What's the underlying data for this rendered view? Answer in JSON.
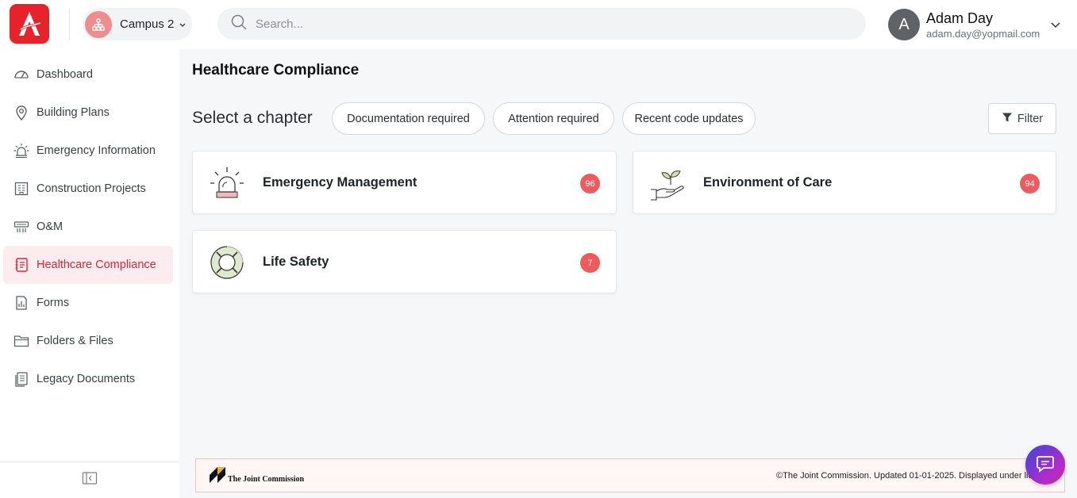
{
  "header": {
    "campus_label": "Campus 2",
    "search_placeholder": "Search...",
    "user": {
      "initial": "A",
      "name": "Adam Day",
      "email": "adam.day@yopmail.com"
    }
  },
  "sidebar": {
    "items": [
      {
        "label": "Dashboard",
        "icon": "speedometer-icon",
        "active": false
      },
      {
        "label": "Building Plans",
        "icon": "map-pin-icon",
        "active": false
      },
      {
        "label": "Emergency Information",
        "icon": "alarm-light-icon",
        "active": false
      },
      {
        "label": "Construction Projects",
        "icon": "building-icon",
        "active": false
      },
      {
        "label": "O&M",
        "icon": "hvac-unit-icon",
        "active": false
      },
      {
        "label": "Healthcare Compliance",
        "icon": "clipboard-icon",
        "active": true
      },
      {
        "label": "Forms",
        "icon": "form-chart-icon",
        "active": false
      },
      {
        "label": "Folders & Files",
        "icon": "folder-icon",
        "active": false
      },
      {
        "label": "Legacy Documents",
        "icon": "documents-icon",
        "active": false
      }
    ]
  },
  "main": {
    "page_title": "Healthcare Compliance",
    "chapter_label": "Select a chapter",
    "chips": [
      "Documentation required",
      "Attention required",
      "Recent code updates"
    ],
    "filter_label": "Filter",
    "chapters": [
      {
        "title": "Emergency Management",
        "count": "96",
        "icon": "siren-icon"
      },
      {
        "title": "Environment of Care",
        "count": "94",
        "icon": "hand-plant-icon"
      },
      {
        "title": "Life Safety",
        "count": "7",
        "icon": "lifebuoy-icon"
      }
    ]
  },
  "footer": {
    "brand": "The Joint Commission",
    "note": "©The Joint Commission. Updated 01-01-2025. Displayed under lic"
  },
  "colors": {
    "brand_red": "#e8222b",
    "active_nav_bg": "#fdecef",
    "active_nav_text": "#d6293a",
    "badge": "#ef5a5d"
  }
}
